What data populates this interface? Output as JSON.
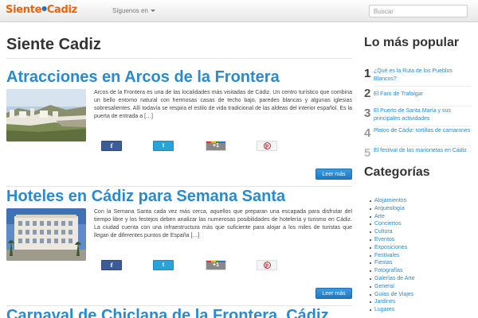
{
  "navbar": {
    "logo_part1": "Siente",
    "logo_dot": "●",
    "logo_part2": "Cadiz",
    "follow_label": "Síguenos en",
    "search_placeholder": "Buscar"
  },
  "main": {
    "page_title": "Siente Cadiz",
    "articles": [
      {
        "title": "Atracciones en Arcos de la Frontera",
        "excerpt": "Arcos de la Frontera es una de las localidades más visitadas de Cádiz. Un centro turístico que combina un bello entorno natural con hermosas casas de techo bajo, paredes blancas y algunas iglesias sobresalientes. Allí todavía se respira el estilo de vida tradicional de las aldeas del interior español. Es la puerta de entrada a ",
        "more_link": "[…]",
        "read_more": "Leer más"
      },
      {
        "title": "Hoteles en Cádiz para Semana Santa",
        "excerpt": "Con la Semana Santa cada vez más cerca, aquellos que preparan una escapada para disfrutar del tiempo libre y los festejos deben analizar las numerosas posibilidades de hotelería y turismo en Cádiz. La ciudad cuenta con una infraestructura más que suficiente para alojar a los miles de turistas que llegan de diferentes puntos de España ",
        "more_link": "[…]",
        "read_more": "Leer más"
      },
      {
        "title": "Carnaval de Chiclana de la Frontera, Cádiz"
      }
    ],
    "share": {
      "facebook": "f",
      "twitter": "t",
      "googleplus": "+1",
      "pinterest": "p"
    }
  },
  "sidebar": {
    "popular_title": "Lo más popular",
    "popular": [
      {
        "num": "1",
        "label": "¿Qué es la Ruta de los Pueblos Blancos?",
        "color": "#333333"
      },
      {
        "num": "2",
        "label": "El Faro de Trafalgar",
        "color": "#555555"
      },
      {
        "num": "3",
        "label": "El Puerto de Santa María y sus principales actividades",
        "color": "#777777"
      },
      {
        "num": "4",
        "label": "Platos de Cádiz: tortillas de camarones",
        "color": "#999999"
      },
      {
        "num": "5",
        "label": "El festival de las marionetas en Cádiz",
        "color": "#bbbbbb"
      }
    ],
    "categories_title": "Categorías",
    "categories": [
      "Alojamientos",
      "Arqueología",
      "Arte",
      "Conciertos",
      "Cultura",
      "Eventos",
      "Exposiciones",
      "Festivales",
      "Fiestas",
      "Fotografías",
      "Galerías de Arte",
      "General",
      "Guías de Viajes",
      "Jardines",
      "Lugares"
    ]
  },
  "colors": {
    "link": "#2a8ad0",
    "logo": "#e8650c",
    "button": "#2a8ad0"
  }
}
